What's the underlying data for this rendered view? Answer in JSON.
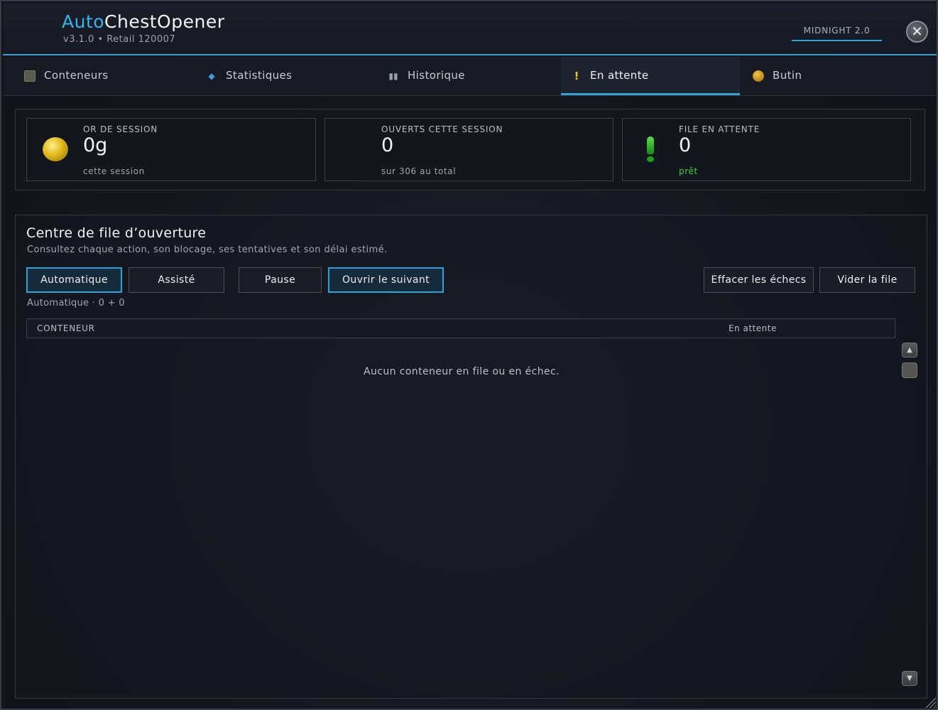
{
  "header": {
    "title_part1": "Auto",
    "title_part2": "ChestOpener",
    "subtitle": "v3.1.0  •  Retail 120007",
    "badge": "MIDNIGHT 2.0",
    "close_label": "✕"
  },
  "tabs": [
    {
      "label": "Conteneurs",
      "icon": "chest-icon"
    },
    {
      "label": "Statistiques",
      "icon": "diamond-icon"
    },
    {
      "label": "Historique",
      "icon": "book-icon"
    },
    {
      "label": "En attente",
      "icon": "exclamation-icon",
      "active": true
    },
    {
      "label": "Butin",
      "icon": "coins-icon"
    }
  ],
  "stats": [
    {
      "caption": "OR DE SESSION",
      "value": "0g",
      "sub": "cette session",
      "icon": "gold-coin-icon"
    },
    {
      "caption": "OUVERTS CETTE SESSION",
      "value": "0",
      "sub": "sur 306 au total"
    },
    {
      "caption": "FILE EN ATTENTE",
      "value": "0",
      "sub": "prêt",
      "icon": "green-exclamation-icon"
    }
  ],
  "panel": {
    "title": "Centre de file d’ouverture",
    "description": "Consultez chaque action, son blocage, ses tentatives et son délai estimé.",
    "buttons": {
      "auto": "Automatique",
      "assisted": "Assisté",
      "pause": "Pause",
      "open_next": "Ouvrir le suivant",
      "clear_failures": "Effacer les échecs",
      "empty_queue": "Vider la file"
    },
    "mode_status": "Automatique · 0 + 0",
    "table": {
      "col_container": "CONTENEUR",
      "col_status": "En attente",
      "empty_message": "Aucun conteneur en file ou en échec."
    }
  },
  "colors": {
    "accent": "#2fa3d6",
    "ready_green": "#3ecf3e"
  }
}
